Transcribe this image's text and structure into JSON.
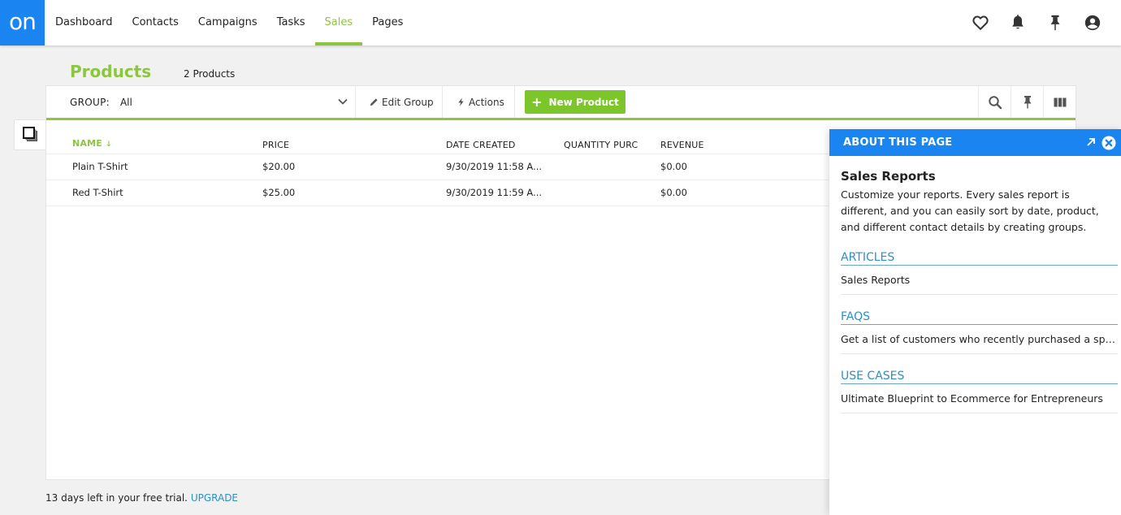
{
  "nav": {
    "logo": "on",
    "items": [
      {
        "label": "Dashboard",
        "active": false
      },
      {
        "label": "Contacts",
        "active": false
      },
      {
        "label": "Campaigns",
        "active": false
      },
      {
        "label": "Tasks",
        "active": false
      },
      {
        "label": "Sales",
        "active": true
      },
      {
        "label": "Pages",
        "active": false
      }
    ],
    "icons": [
      "heart-icon",
      "bell-icon",
      "pin-icon",
      "user-account-icon"
    ]
  },
  "page": {
    "title": "Products",
    "count": "2 Products"
  },
  "toolbar": {
    "group_label": "GROUP:",
    "group_value": "All",
    "edit_group": "Edit Group",
    "actions": "Actions",
    "new_product": "New Product",
    "right_icons": [
      "search-icon",
      "pin-icon",
      "columns-icon"
    ]
  },
  "table": {
    "columns": [
      {
        "label": "NAME",
        "sorted": true,
        "sort_dir": "desc"
      },
      {
        "label": "PRICE"
      },
      {
        "label": "DATE CREATED"
      },
      {
        "label": "QUANTITY PURC"
      },
      {
        "label": "REVENUE"
      }
    ],
    "rows": [
      {
        "name": "Plain T-Shirt",
        "price": "$20.00",
        "date": "9/30/2019 11:58 A...",
        "qty": "",
        "revenue": "$0.00"
      },
      {
        "name": "Red T-Shirt",
        "price": "$25.00",
        "date": "9/30/2019 11:59 A...",
        "qty": "",
        "revenue": "$0.00"
      }
    ]
  },
  "footer": {
    "trial_text": "13 days left in your free trial.",
    "upgrade": "UPGRADE"
  },
  "about": {
    "header": "ABOUT THIS PAGE",
    "heading": "Sales Reports",
    "description": "Customize your reports. Every sales report is different, and you can easily sort by date, product, and different contact details by creating groups.",
    "sections": [
      {
        "title": "ARTICLES",
        "items": [
          "Sales Reports"
        ]
      },
      {
        "title": "FAQS",
        "items": [
          "Get a list of customers who recently purchased a spe..."
        ]
      },
      {
        "title": "USE CASES",
        "items": [
          "Ultimate Blueprint to Ecommerce for Entrepreneurs"
        ]
      }
    ]
  },
  "colors": {
    "brand_blue": "#1a85f0",
    "accent_green": "#8cc63f",
    "button_green": "#7cc52a",
    "link_blue": "#2b8fcb"
  }
}
